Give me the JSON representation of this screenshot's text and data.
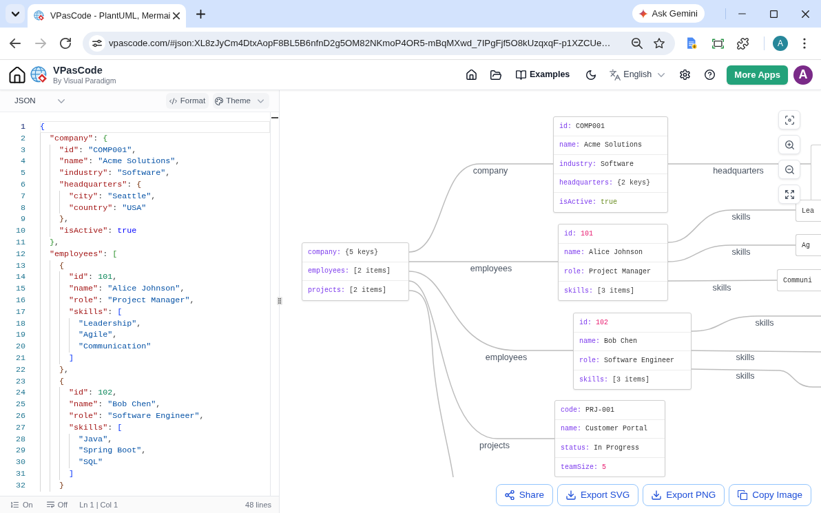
{
  "browser": {
    "tab_title": "VPasCode - PlantUML, Mermai",
    "gemini_button": "Ask Gemini",
    "url": "vpascode.com/#json:XL8zJyCm4DtxAopF8BL5B6nfnD2g5OM82NKmoP4OR5-mBqMXwd_7IPgFjf5O8kUzqxqF-p1XZCUe…",
    "profile": "A"
  },
  "app_header": {
    "title": "VPasCode",
    "subtitle": "By Visual Paradigm",
    "examples": "Examples",
    "language": "English",
    "more_apps": "More Apps",
    "avatar": "A"
  },
  "editor": {
    "language": "JSON",
    "format_button": "Format",
    "theme_button": "Theme",
    "lines": [
      {
        "number": "1",
        "text": "{",
        "current": true
      },
      {
        "number": "2",
        "text": "  \"company\": {",
        "current": false
      },
      {
        "number": "3",
        "text": "    \"id\": \"COMP001\",",
        "current": false
      },
      {
        "number": "4",
        "text": "    \"name\": \"Acme Solutions\",",
        "current": false
      },
      {
        "number": "5",
        "text": "    \"industry\": \"Software\",",
        "current": false
      },
      {
        "number": "6",
        "text": "    \"headquarters\": {",
        "current": false
      },
      {
        "number": "7",
        "text": "      \"city\": \"Seattle\",",
        "current": false
      },
      {
        "number": "8",
        "text": "      \"country\": \"USA\"",
        "current": false
      },
      {
        "number": "9",
        "text": "    },",
        "current": false
      },
      {
        "number": "10",
        "text": "    \"isActive\": true",
        "current": false
      },
      {
        "number": "11",
        "text": "  },",
        "current": false
      },
      {
        "number": "12",
        "text": "  \"employees\": [",
        "current": false
      },
      {
        "number": "13",
        "text": "    {",
        "current": false
      },
      {
        "number": "14",
        "text": "      \"id\": 101,",
        "current": false
      },
      {
        "number": "15",
        "text": "      \"name\": \"Alice Johnson\",",
        "current": false
      },
      {
        "number": "16",
        "text": "      \"role\": \"Project Manager\",",
        "current": false
      },
      {
        "number": "17",
        "text": "      \"skills\": [",
        "current": false
      },
      {
        "number": "18",
        "text": "        \"Leadership\",",
        "current": false
      },
      {
        "number": "19",
        "text": "        \"Agile\",",
        "current": false
      },
      {
        "number": "20",
        "text": "        \"Communication\"",
        "current": false
      },
      {
        "number": "21",
        "text": "      ]",
        "current": false
      },
      {
        "number": "22",
        "text": "    },",
        "current": false
      },
      {
        "number": "23",
        "text": "    {",
        "current": false
      },
      {
        "number": "24",
        "text": "      \"id\": 102,",
        "current": false
      },
      {
        "number": "25",
        "text": "      \"name\": \"Bob Chen\",",
        "current": false
      },
      {
        "number": "26",
        "text": "      \"role\": \"Software Engineer\",",
        "current": false
      },
      {
        "number": "27",
        "text": "      \"skills\": [",
        "current": false
      },
      {
        "number": "28",
        "text": "        \"Java\",",
        "current": false
      },
      {
        "number": "29",
        "text": "        \"Spring Boot\",",
        "current": false
      },
      {
        "number": "30",
        "text": "        \"SQL\"",
        "current": false
      },
      {
        "number": "31",
        "text": "      ]",
        "current": false
      },
      {
        "number": "32",
        "text": "    }",
        "current": false
      }
    ],
    "status_bar": {
      "line_numbers": "On",
      "word_wrap": "Off",
      "position": "Ln 1 | Col 1",
      "line_count": "48 lines"
    }
  },
  "diagram": {
    "nodes": [
      {
        "kind": "record",
        "fields": [
          {
            "key": "company:",
            "value": "{5 keys}",
            "kind": "summary"
          },
          {
            "key": "employees:",
            "value": "[2 items]",
            "kind": "summary"
          },
          {
            "key": "projects:",
            "value": "[2 items]",
            "kind": "summary"
          }
        ]
      },
      {
        "kind": "record",
        "fields": [
          {
            "key": "id:",
            "value": "COMP001",
            "kind": "string"
          },
          {
            "key": "name:",
            "value": "Acme Solutions",
            "kind": "string"
          },
          {
            "key": "industry:",
            "value": "Software",
            "kind": "string"
          },
          {
            "key": "headquarters:",
            "value": "{2 keys}",
            "kind": "summary"
          },
          {
            "key": "isActive:",
            "value": "true",
            "kind": "boolean"
          }
        ]
      },
      {
        "kind": "clipped"
      },
      {
        "kind": "record",
        "fields": [
          {
            "key": "id:",
            "value": "101",
            "kind": "number"
          },
          {
            "key": "name:",
            "value": "Alice Johnson",
            "kind": "string"
          },
          {
            "key": "role:",
            "value": "Project Manager",
            "kind": "string"
          },
          {
            "key": "skills:",
            "value": "[3 items]",
            "kind": "summary"
          }
        ]
      },
      {
        "kind": "value",
        "text": "Lea"
      },
      {
        "kind": "value",
        "text": "Ag"
      },
      {
        "kind": "value",
        "text": "Communi"
      },
      {
        "kind": "record",
        "fields": [
          {
            "key": "id:",
            "value": "102",
            "kind": "number"
          },
          {
            "key": "name:",
            "value": "Bob Chen",
            "kind": "string"
          },
          {
            "key": "role:",
            "value": "Software Engineer",
            "kind": "string"
          },
          {
            "key": "skills:",
            "value": "[3 items]",
            "kind": "summary"
          }
        ]
      },
      {
        "kind": "record",
        "fields": [
          {
            "key": "code:",
            "value": "PRJ-001",
            "kind": "string"
          },
          {
            "key": "name:",
            "value": "Customer Portal",
            "kind": "string"
          },
          {
            "key": "status:",
            "value": "In Progress",
            "kind": "string"
          },
          {
            "key": "teamSize:",
            "value": "5",
            "kind": "number"
          }
        ]
      }
    ],
    "edges": [
      {
        "kind": "labeled",
        "label": "company"
      },
      {
        "kind": "labeled",
        "label": "employees"
      },
      {
        "kind": "labeled",
        "label": "employees"
      },
      {
        "kind": "labeled",
        "label": "projects"
      },
      {
        "kind": "plain"
      },
      {
        "kind": "labeled",
        "label": "headquarters"
      },
      {
        "kind": "labeled",
        "label": "skills"
      },
      {
        "kind": "labeled",
        "label": "skills"
      },
      {
        "kind": "labeled",
        "label": "skills"
      },
      {
        "kind": "labeled",
        "label": "skills"
      },
      {
        "kind": "labeled",
        "label": "skills"
      },
      {
        "kind": "labeled",
        "label": "skills"
      }
    ],
    "actions": [
      "Share",
      "Export SVG",
      "Export PNG",
      "Copy Image"
    ]
  }
}
